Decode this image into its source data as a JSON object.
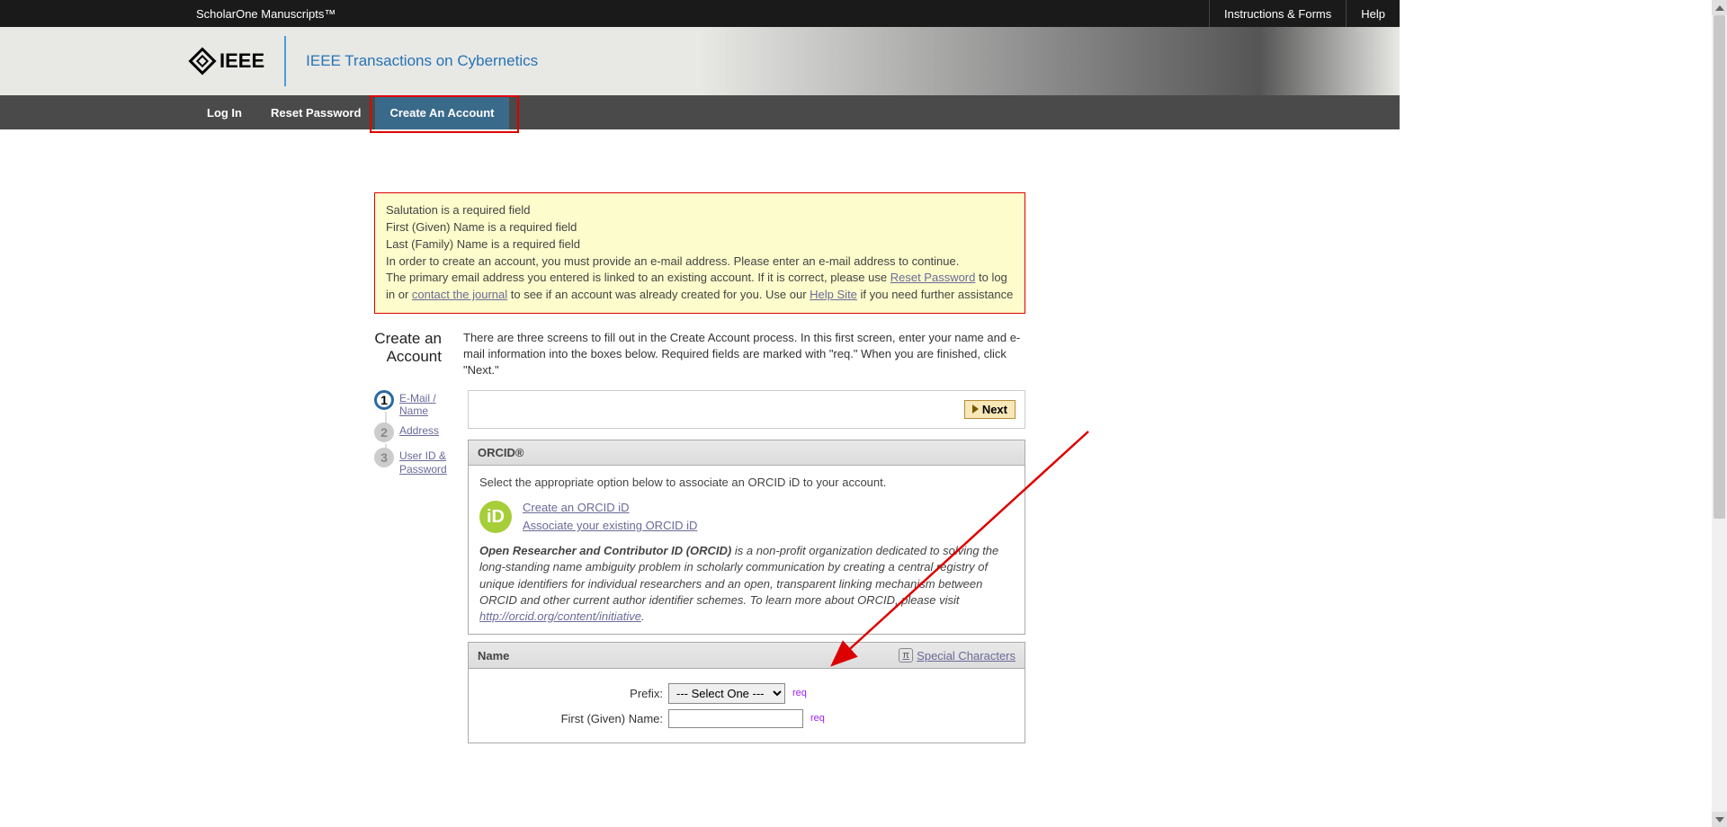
{
  "topbar": {
    "brand": "ScholarOne Manuscripts™",
    "links": [
      "Instructions & Forms",
      "Help"
    ]
  },
  "header": {
    "logo_text": "IEEE",
    "journal": "IEEE Transactions on Cybernetics"
  },
  "nav": {
    "items": [
      {
        "label": "Log In",
        "active": false
      },
      {
        "label": "Reset Password",
        "active": false
      },
      {
        "label": "Create An Account",
        "active": true
      }
    ]
  },
  "alert": {
    "lines": [
      "Salutation is a required field",
      "First (Given) Name is a required field",
      "Last (Family) Name is a required field",
      "In order to create an account, you must provide an e-mail address. Please enter an e-mail address to continue."
    ],
    "line5_pre": "The primary email address you entered is linked to an existing account. If it is correct, please use ",
    "reset_pw": "Reset Password",
    "line5_mid": " to log in or ",
    "contact_journal": "contact the journal",
    "line5_mid2": " to see if an account was already created for you. Use our ",
    "help_site": "Help Site",
    "line5_post": " if you need further assistance"
  },
  "section": {
    "title_l1": "Create an",
    "title_l2": "Account",
    "intro": "There are three screens to fill out in the Create Account process. In this first screen, enter your name and e-mail information into the boxes below. Required fields are marked with \"req.\" When you are finished, click \"Next.\""
  },
  "steps": [
    {
      "num": "1",
      "label": "E-Mail / Name"
    },
    {
      "num": "2",
      "label": "Address"
    },
    {
      "num": "3",
      "label": "User ID & Password"
    }
  ],
  "next_label": "Next",
  "orcid": {
    "header": "ORCID®",
    "prompt": "Select the appropriate option below to associate an ORCID iD to your account.",
    "create_link": "Create an ORCID iD",
    "associate_link": "Associate your existing ORCID iD",
    "badge": "iD",
    "desc_strong": "Open Researcher and Contributor ID (ORCID)",
    "desc_rest": " is a non-profit organization dedicated to solving the long-standing name ambiguity problem in scholarly communication by creating a central registry of unique identifiers for individual researchers and an open, transparent linking mechanism between ORCID and other current author identifier schemes. To learn more about ORCID, please visit ",
    "desc_link": "http://orcid.org/content/initiative",
    "desc_end": "."
  },
  "name_panel": {
    "header": "Name",
    "special_chars": "Special Characters",
    "prefix_label": "Prefix:",
    "prefix_selected": "--- Select One ---",
    "first_label": "First (Given) Name:",
    "req": "req"
  }
}
